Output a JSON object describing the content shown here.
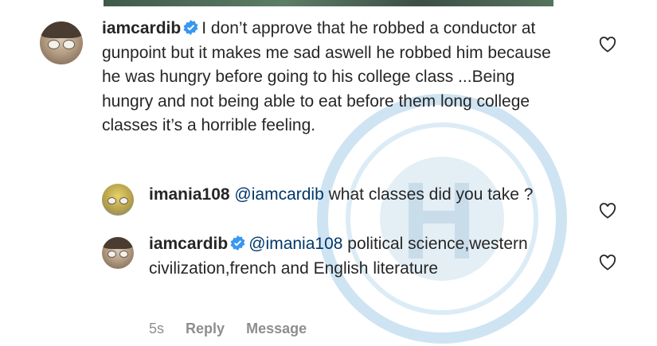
{
  "comments": [
    {
      "username": "iamcardib",
      "verified": true,
      "text": "I don’t approve that he robbed a conductor at gunpoint but it makes me sad aswell he robbed him because he was hungry before going to his college class ...Being hungry and not being able to eat before them long college classes it’s a horrible feeling."
    }
  ],
  "replies": [
    {
      "username": "imania108",
      "verified": false,
      "mention": "@iamcardib",
      "text": "what classes did you take ?"
    },
    {
      "username": "iamcardib",
      "verified": true,
      "mention": "@imania108",
      "text": "political science,western civilization,french and English literature"
    }
  ],
  "meta": {
    "time": "5s",
    "reply_label": "Reply",
    "message_label": "Message"
  },
  "icons": {
    "verified": "verified-badge-icon",
    "like": "heart-outline-icon"
  },
  "colors": {
    "text": "#262626",
    "mention": "#00376b",
    "verified": "#3897f0",
    "secondary": "#8e8e8e"
  }
}
